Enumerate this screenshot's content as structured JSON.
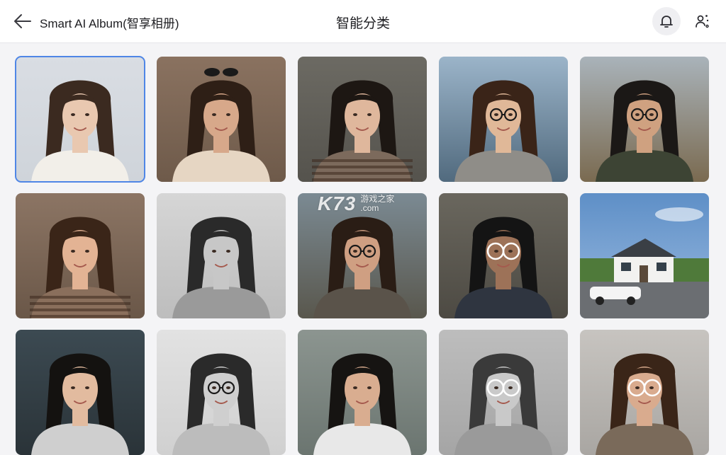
{
  "header": {
    "app_title": "Smart AI Album(智享相册)",
    "page_title": "智能分类",
    "back_icon": "arrow-left-icon",
    "notification_icon": "bell-icon",
    "ai_icon": "face-sparkle-icon"
  },
  "watermark": {
    "logo": "K73",
    "line1": "游戏之家",
    "line2": ".com"
  },
  "colors": {
    "accent": "#4f86e6",
    "background": "#f4f4f6"
  },
  "photos": [
    {
      "kind": "portrait",
      "bg": "#d9dde3",
      "bg2": "#cfd4da",
      "hair": "#3b2a20",
      "skin": "#e9c8b0",
      "cloth": "#f2efe9",
      "selected": true
    },
    {
      "kind": "portrait",
      "bg": "#8a7260",
      "bg2": "#6e5a4a",
      "hair": "#2e1f16",
      "skin": "#d7a88a",
      "cloth": "#e6d6c3",
      "sunglasses": true
    },
    {
      "kind": "portrait",
      "bg": "#6c6a63",
      "bg2": "#55534d",
      "hair": "#1d1713",
      "skin": "#dfb79c",
      "cloth": "#7c6a5c",
      "stripes": true
    },
    {
      "kind": "portrait",
      "bg": "#9bb4c9",
      "bg2": "#516a7e",
      "hair": "#3a2418",
      "skin": "#e0b898",
      "cloth": "#8f8d88",
      "glasses": true
    },
    {
      "kind": "portrait",
      "bg": "#a9b3ba",
      "bg2": "#7a6a50",
      "hair": "#1b1816",
      "skin": "#cfa180",
      "cloth": "#3d4434",
      "glasses": true
    },
    {
      "kind": "portrait",
      "bg": "#8c7564",
      "bg2": "#6a5748",
      "hair": "#3a2518",
      "skin": "#e3b394",
      "cloth": "#8a6f5c",
      "stripes": true
    },
    {
      "kind": "portrait",
      "bg": "#d6d6d6",
      "bg2": "#bdbdbd",
      "hair": "#2a2a2a",
      "skin": "#c7c7c7",
      "cloth": "#9a9a9a"
    },
    {
      "kind": "portrait",
      "bg": "#7b8a93",
      "bg2": "#59574d",
      "hair": "#2a1d15",
      "skin": "#cf9f82",
      "cloth": "#5a534a",
      "glasses": true
    },
    {
      "kind": "portrait",
      "bg": "#6a675e",
      "bg2": "#4d4a43",
      "hair": "#141414",
      "skin": "#9d7258",
      "cloth": "#2f3540",
      "rings": true
    },
    {
      "kind": "house",
      "bg": "#5e8fc7",
      "bg2": "#9bbbe0"
    },
    {
      "kind": "portrait",
      "bg": "#3c4a52",
      "bg2": "#2a3338",
      "hair": "#141210",
      "skin": "#e2bb9f",
      "cloth": "#cfcfcf"
    },
    {
      "kind": "portrait",
      "bg": "#e2e2e2",
      "bg2": "#d0d0d0",
      "hair": "#2a2a2a",
      "skin": "#cfcfcf",
      "cloth": "#bcbcbc",
      "glasses": true
    },
    {
      "kind": "portrait",
      "bg": "#8c9590",
      "bg2": "#6b7570",
      "hair": "#161412",
      "skin": "#d9ad90",
      "cloth": "#e8e8e8"
    },
    {
      "kind": "portrait",
      "bg": "#bdbdbd",
      "bg2": "#a5a5a5",
      "hair": "#3a3a3a",
      "skin": "#c9c9c9",
      "cloth": "#9a9a9a",
      "rings": true
    },
    {
      "kind": "portrait",
      "bg": "#c7c4c0",
      "bg2": "#a9a6a2",
      "hair": "#3a2518",
      "skin": "#d9ab8e",
      "cloth": "#7a6a5a",
      "rings": true
    }
  ]
}
